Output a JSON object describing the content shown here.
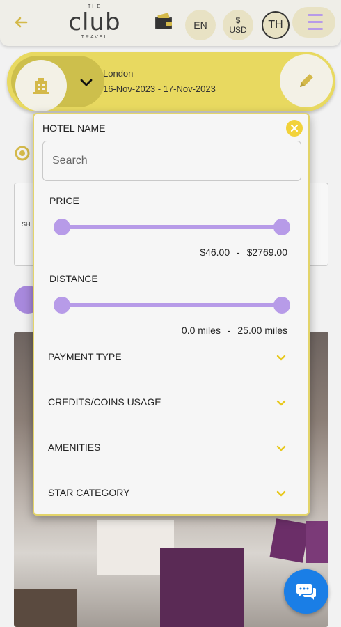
{
  "header": {
    "logo_top": "THE",
    "logo_main": "club",
    "logo_sub": "TRAVEL",
    "language": "EN",
    "currency_symbol": "$",
    "currency_code": "USD",
    "user_initials": "TH"
  },
  "search_summary": {
    "city": "London",
    "dates": "16-Nov-2023 - 17-Nov-2023"
  },
  "background": {
    "card_label": "SH"
  },
  "filter_modal": {
    "title": "HOTEL NAME",
    "search_placeholder": "Search",
    "price": {
      "label": "PRICE",
      "min": "$46.00",
      "max": "$2769.00",
      "separator": "-"
    },
    "distance": {
      "label": "DISTANCE",
      "min": "0.0 miles",
      "max": "25.00 miles",
      "separator": "-"
    },
    "sections": [
      {
        "label": "PAYMENT TYPE"
      },
      {
        "label": "CREDITS/COINS USAGE"
      },
      {
        "label": "AMENITIES"
      },
      {
        "label": "STAR CATEGORY"
      }
    ]
  },
  "colors": {
    "accent_yellow": "#e8d960",
    "accent_purple": "#b79be8",
    "chat_blue": "#1a7ee6"
  }
}
